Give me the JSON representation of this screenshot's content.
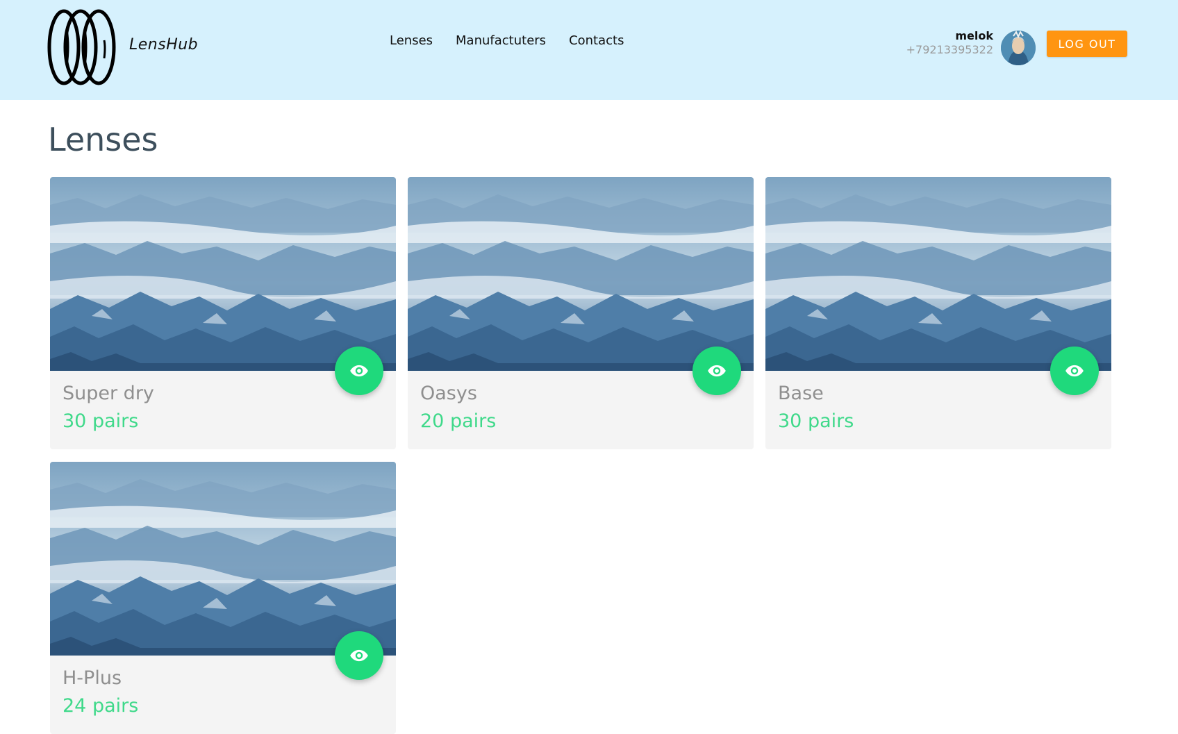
{
  "header": {
    "brand": "LensHub",
    "nav": [
      {
        "label": "Lenses"
      },
      {
        "label": "Manufactuters"
      },
      {
        "label": "Contacts"
      }
    ],
    "user": {
      "name": "melok",
      "phone": "+79213395322"
    },
    "logout_label": "LOG OUT"
  },
  "main": {
    "title": "Lenses",
    "cards": [
      {
        "title": "Super dry",
        "count": "30 pairs"
      },
      {
        "title": "Oasys",
        "count": "20 pairs"
      },
      {
        "title": "Base",
        "count": "30 pairs"
      },
      {
        "title": "H-Plus",
        "count": "24 pairs"
      }
    ]
  },
  "colors": {
    "header_bg": "#d6f1fd",
    "accent_orange": "#ff9511",
    "accent_green": "#1fd97c",
    "count_green": "#3fd98a",
    "title_dark": "#3d4f5c"
  },
  "icons": {
    "logo": "lens-logo-icon",
    "view": "eye-icon"
  }
}
